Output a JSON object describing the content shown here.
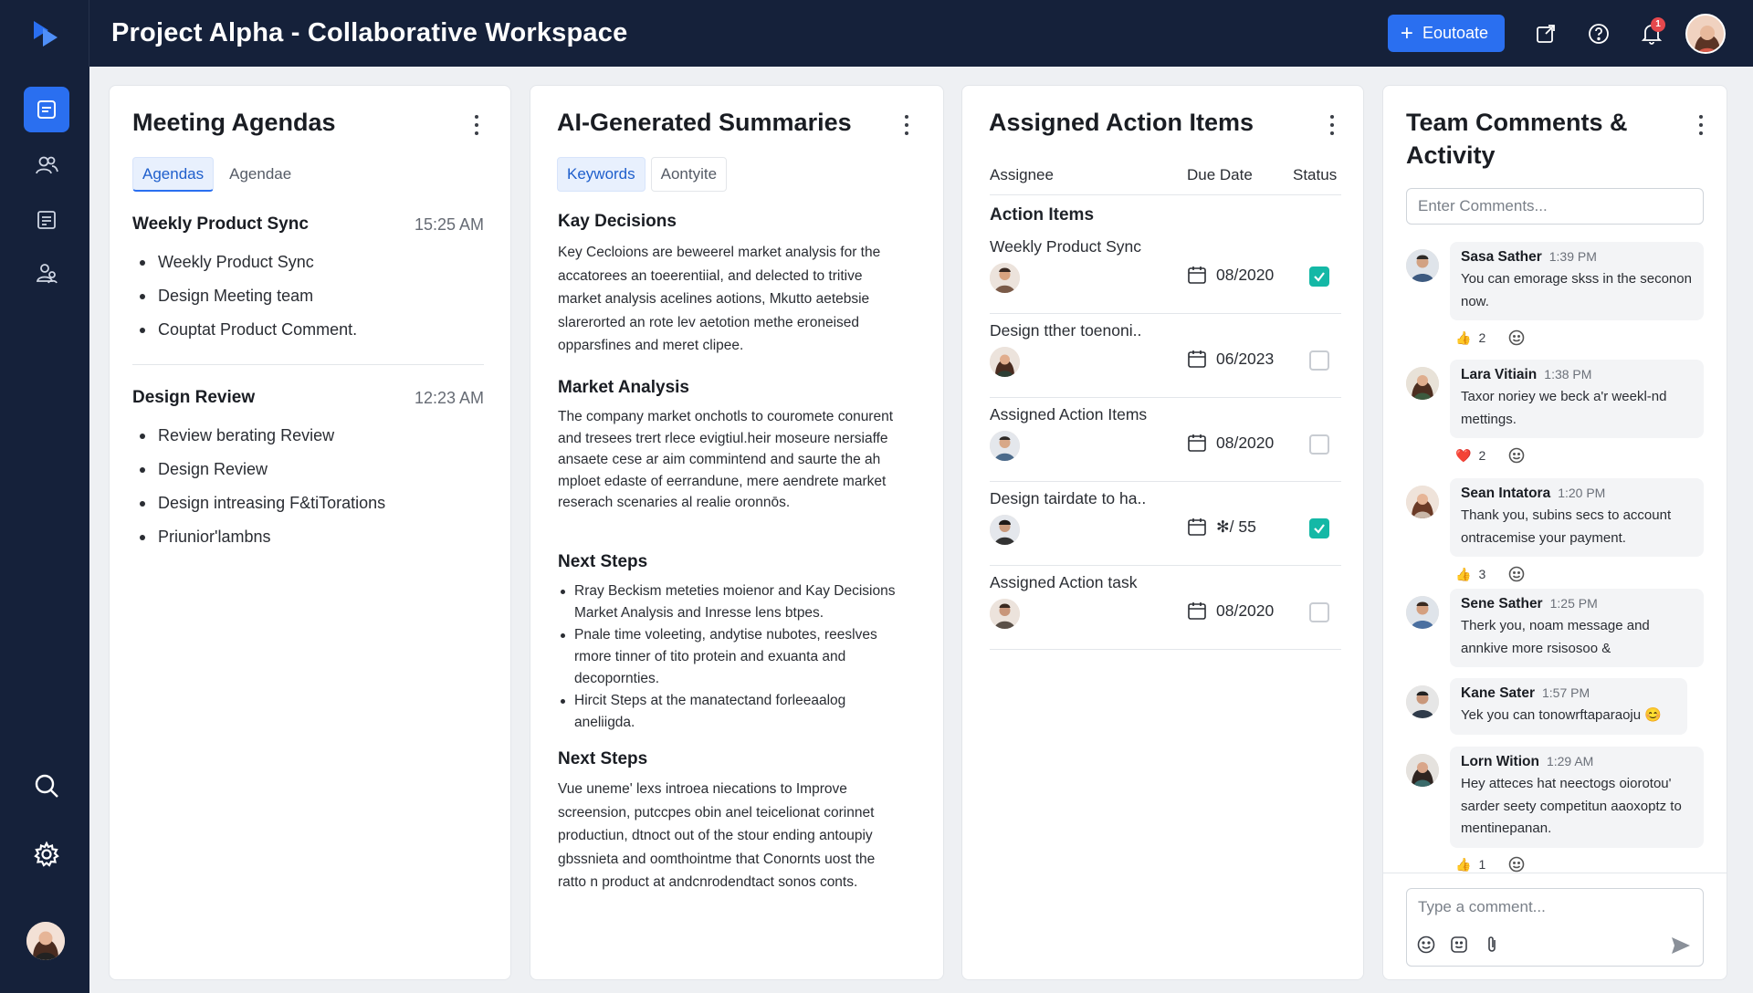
{
  "app": {
    "title": "Project Alpha - Collaborative Workspace"
  },
  "topbar": {
    "primary_button": "Eoutoate",
    "notification_count": "1"
  },
  "colors": {
    "navy": "#15213a",
    "accent": "#2a6ff0",
    "teal": "#14b8a6"
  },
  "agendas": {
    "title": "Meeting Agendas",
    "tabs": [
      "Agendas",
      "Agendae"
    ],
    "meetings": [
      {
        "name": "Weekly Product Sync",
        "time": "15:25 AM",
        "items": [
          "Weekly Product Sync",
          "Design Meeting team",
          "Couptat Product Comment."
        ]
      },
      {
        "name": "Design Review",
        "time": "12:23 AM",
        "items": [
          "Review berating Review",
          "Design Review",
          "Design intreasing F&tiTorations",
          "Priunior'lambns"
        ]
      }
    ]
  },
  "summaries": {
    "title": "AI-Generated Summaries",
    "tabs": [
      "Keywords",
      "Aontyite"
    ],
    "kay_decisions": {
      "heading": "Kay Decisions",
      "text": "Key Cecloions are beweerel market analysis for the accatorees an toeerentiial, and delected to tritive market analysis acelines aotions, Mkutto aetebsie slarerorted an rote lev aetotion methe eroneised opparsfines and meret clipee."
    },
    "market_analysis": {
      "heading": "Market Analysis",
      "text": "The company market onchotls to couromete conurent and tresees trert rlece evigtiul.heir moseure nersiaffe ansaete cese ar aim commintend and saurte the ah mploet edaste of eerrandune, mere aendrete market reserach scenaries al realie oronnōs."
    },
    "next_steps_1": {
      "heading": "Next Steps",
      "items": [
        "Rray Beckism meteties moienor and Kay Decisions Market Analysis and Inresse lens btpes.",
        "Pnale time voleeting, andytise nubotes, reeslves rmore tinner of tito protein and exuanta and decopornties.",
        "Hircit Steps at the manatectand forleeaalog aneliigda."
      ]
    },
    "next_steps_2": {
      "heading": "Next Steps",
      "text": "Vue uneme' lexs introea niecations to Improve screension, putccpes obin anel teicelionat corinnet productiun, dtnoct out of the stour ending antoupiy gbssnieta and oomthointme that Conornts uost the ratto n product at andcnrodendtact sonos conts."
    }
  },
  "actions": {
    "title": "Assigned Action Items",
    "columns": {
      "assignee": "Assignee",
      "due": "Due Date",
      "status": "Status"
    },
    "section": "Action Items",
    "rows": [
      {
        "title": "Weekly Product Sync",
        "due": "08/2020",
        "done": true
      },
      {
        "title": "Design tther toenoni..",
        "due": "06/2023",
        "done": false
      },
      {
        "title": "Assigned Action Items",
        "due": "08/2020",
        "done": false
      },
      {
        "title": "Design tairdate to ha..",
        "due": "✻/ 55",
        "done": true
      },
      {
        "title": "Assigned Action task",
        "due": "08/2020",
        "done": false
      }
    ]
  },
  "comments": {
    "title": "Team Comments & Activity",
    "search_placeholder": "Enter Comments...",
    "items": [
      {
        "name": "Sasa Sather",
        "time": "1:39 PM",
        "text": "You can emorage skss in the seconon now.",
        "reaction": "👍",
        "count": "2"
      },
      {
        "name": "Lara Vitiain",
        "time": "1:38 PM",
        "text": "Taxor noriey we beck a'r weekl-nd mettings.",
        "reaction": "❤️",
        "count": "2"
      },
      {
        "name": "Sean Intatora",
        "time": "1:20 PM",
        "text": "Thank you, subins secs to account ontracemise your payment.",
        "reaction": "👍",
        "count": "3"
      },
      {
        "name": "Sene Sather",
        "time": "1:25 PM",
        "text": "Therk you, noam message and annkive more rsisosoo &",
        "reaction": "",
        "count": ""
      },
      {
        "name": "Kane Sater",
        "time": "1:57 PM",
        "text": "Yek you can tonowrftaparaoju 😊",
        "reaction": "",
        "count": ""
      },
      {
        "name": "Lorn Wition",
        "time": "1:29 AM",
        "text": "Hey atteces hat neectogs oiorotou' sarder seety competitun aaoxoptz to mentinepanan.",
        "reaction": "👍",
        "count": "1"
      }
    ],
    "compose_placeholder": "Type a comment..."
  }
}
